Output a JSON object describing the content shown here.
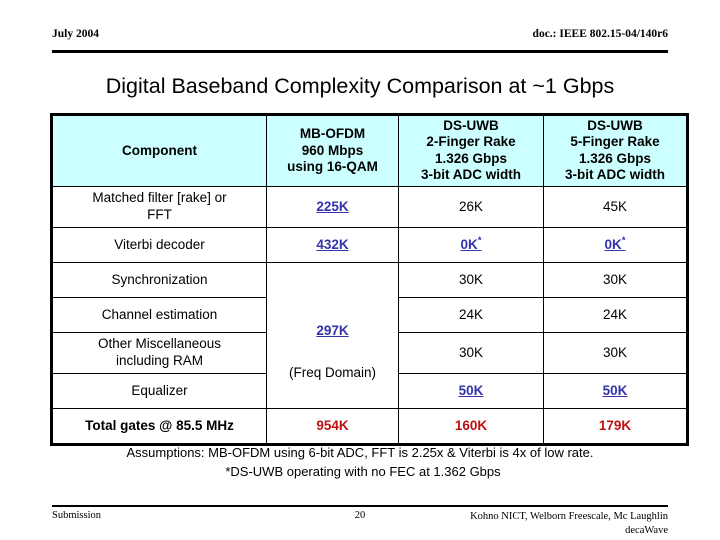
{
  "header": {
    "date": "July 2004",
    "doc_ref": "doc.: IEEE 802.15-04/140r6"
  },
  "title": "Digital Baseband Complexity Comparison at ~1 Gbps",
  "table": {
    "header_bg": "#ccffff",
    "columns": [
      {
        "label": "Component",
        "lines": [
          "Component"
        ]
      },
      {
        "label": "MB-OFDM",
        "lines": [
          "MB-OFDM",
          "960 Mbps",
          "using 16-QAM"
        ]
      },
      {
        "label": "DS-UWB 2-Finger Rake",
        "lines": [
          "DS-UWB",
          "2-Finger Rake",
          "1.326 Gbps",
          "3-bit ADC width"
        ]
      },
      {
        "label": "DS-UWB 5-Finger Rake",
        "lines": [
          "DS-UWB",
          "5-Finger Rake",
          "1.326 Gbps",
          "3-bit ADC width"
        ]
      }
    ],
    "rows": [
      {
        "component_lines": [
          "Matched filter [rake] or",
          "FFT"
        ],
        "mbofdm": "225K",
        "mbofdm_style": "link",
        "ds2": "26K",
        "ds2_style": "plain",
        "ds5": "45K",
        "ds5_style": "plain"
      },
      {
        "component_lines": [
          "Viterbi decoder"
        ],
        "mbofdm": "432K",
        "mbofdm_style": "link",
        "ds2": "0K",
        "ds2_sup": "*",
        "ds2_style": "link",
        "ds5": "0K",
        "ds5_sup": "*",
        "ds5_style": "link"
      },
      {
        "component_lines": [
          "Synchronization"
        ],
        "ds2": "30K",
        "ds2_style": "plain",
        "ds5": "30K",
        "ds5_style": "plain"
      },
      {
        "component_lines": [
          "Channel estimation"
        ],
        "ds2": "24K",
        "ds2_style": "plain",
        "ds5": "24K",
        "ds5_style": "plain"
      },
      {
        "component_lines": [
          "Other Miscellaneous",
          "including RAM"
        ],
        "ds2": "30K",
        "ds2_style": "plain",
        "ds5": "30K",
        "ds5_style": "plain"
      },
      {
        "component_lines": [
          "Equalizer"
        ],
        "ds2": "50K",
        "ds2_style": "link",
        "ds5": "50K",
        "ds5_style": "link"
      }
    ],
    "merged_mbofdm_cell": {
      "value": "297K",
      "value_style": "link",
      "note": "(Freq Domain)",
      "spans_rows": 4
    },
    "total_row": {
      "label": "Total gates @ 85.5 MHz",
      "mbofdm": "954K",
      "ds2": "160K",
      "ds5": "179K",
      "color": "#bb1111"
    }
  },
  "notes": {
    "line1": "Assumptions: MB-OFDM using 6-bit ADC, FFT is 2.25x & Viterbi is 4x of low rate.",
    "line2": "*DS-UWB operating with no FEC at 1.362 Gbps"
  },
  "footer": {
    "left": "Submission",
    "page": "20",
    "right_line1": "Kohno NICT, Welborn Freescale, Mc Laughlin",
    "right_line2": "decaWave"
  }
}
